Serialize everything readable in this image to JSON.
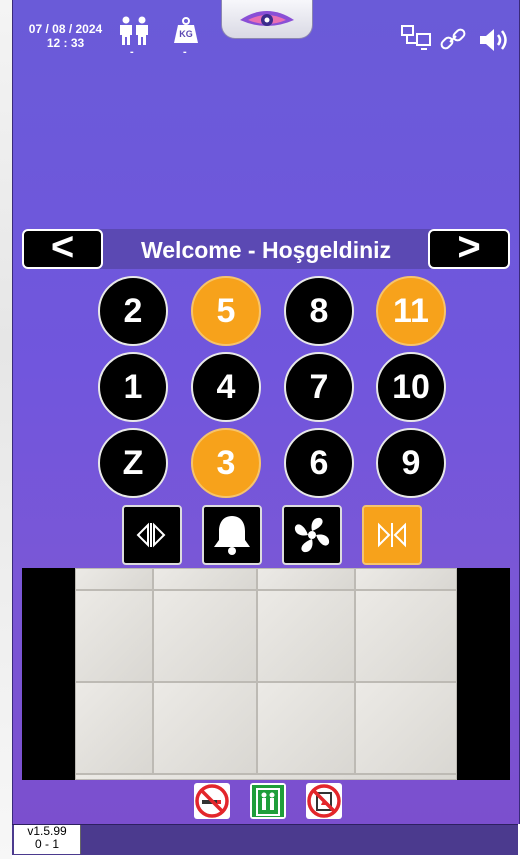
{
  "header": {
    "date": "07 / 08 / 2024",
    "time": "12 : 33",
    "person_count": "-",
    "load_kg": "-",
    "load_icon_text": "KG",
    "icons": [
      "people-icon",
      "weight-icon",
      "network-icon",
      "link-icon",
      "speaker-icon"
    ]
  },
  "nav": {
    "prev_label": "<",
    "next_label": ">",
    "title": "Welcome - Hoşgeldiniz"
  },
  "floors": [
    {
      "label": "2",
      "active": false
    },
    {
      "label": "5",
      "active": true
    },
    {
      "label": "8",
      "active": false
    },
    {
      "label": "11",
      "active": true
    },
    {
      "label": "1",
      "active": false
    },
    {
      "label": "4",
      "active": false
    },
    {
      "label": "7",
      "active": false
    },
    {
      "label": "10",
      "active": false
    },
    {
      "label": "Z",
      "active": false
    },
    {
      "label": "3",
      "active": true
    },
    {
      "label": "6",
      "active": false
    },
    {
      "label": "9",
      "active": false
    }
  ],
  "controls": [
    {
      "name": "door-open-button",
      "icon": "door-open-icon",
      "active": false
    },
    {
      "name": "alarm-bell-button",
      "icon": "bell-icon",
      "active": false
    },
    {
      "name": "fan-button",
      "icon": "fan-icon",
      "active": false
    },
    {
      "name": "door-close-button",
      "icon": "door-close-icon",
      "active": true
    }
  ],
  "signs": [
    "no-smoking-icon",
    "elevator-exit-icon",
    "no-fire-use-elevator-icon"
  ],
  "footer": {
    "version": "v1.5.99",
    "counter": "0 - 1"
  },
  "colors": {
    "background": "#7156dd",
    "active_floor": "#f7a21b",
    "inactive_floor": "#000000"
  }
}
